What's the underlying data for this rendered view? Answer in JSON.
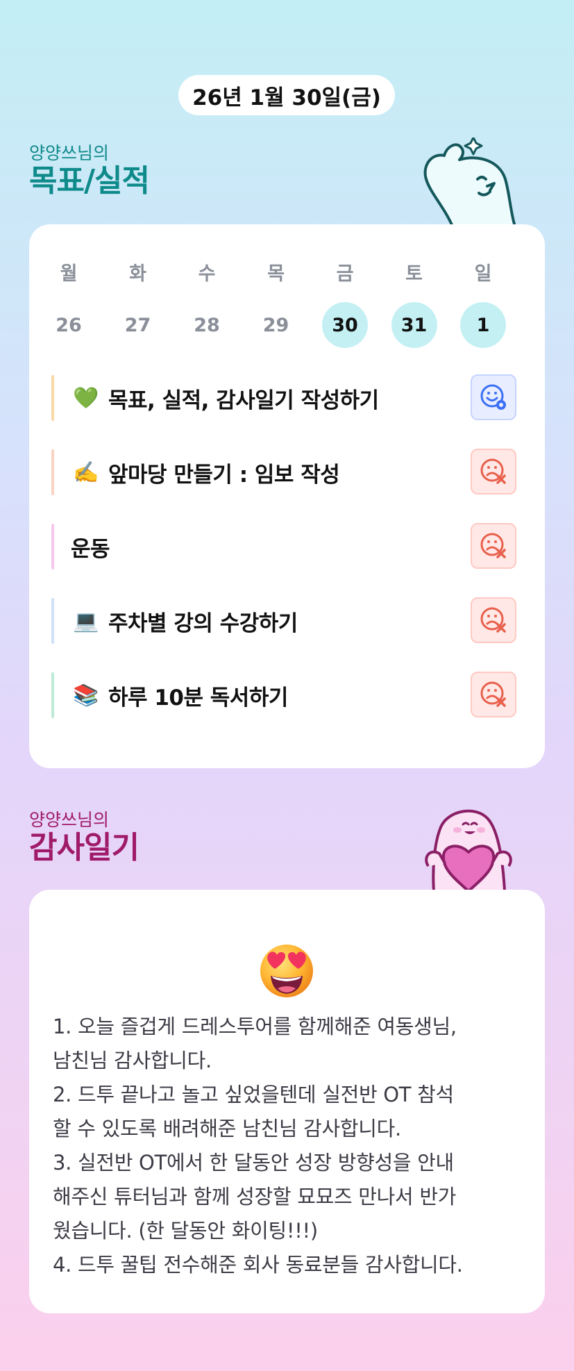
{
  "date": "26년 1월 30일(금)",
  "goal_section": {
    "owner": "양양쓰님의",
    "title": "목표/실적"
  },
  "week": {
    "days": [
      "월",
      "화",
      "수",
      "목",
      "금",
      "토",
      "일"
    ],
    "dates": [
      "26",
      "27",
      "28",
      "29",
      "30",
      "31",
      "1"
    ],
    "active_dates": [
      "30",
      "31",
      "1"
    ]
  },
  "goals": [
    {
      "emoji": "💚",
      "icon": "green-heart-icon",
      "text": "목표, 실적, 감사일기 작성하기",
      "status": "done",
      "bar_color": "#f8d9a8"
    },
    {
      "emoji": "✍️",
      "icon": "writing-hand-icon",
      "text": "앞마당 만들기 : 임보 작성",
      "status": "fail",
      "bar_color": "#fbd3c4"
    },
    {
      "emoji": "",
      "icon": "",
      "text": "운동",
      "status": "fail",
      "bar_color": "#f6c8ec"
    },
    {
      "emoji": "💻",
      "icon": "laptop-icon",
      "text": "주차별 강의 수강하기",
      "status": "fail",
      "bar_color": "#cfe0f7"
    },
    {
      "emoji": "📚",
      "icon": "books-icon",
      "text": "하루 10분 독서하기",
      "status": "fail",
      "bar_color": "#bfead8"
    }
  ],
  "diary_section": {
    "owner": "양양쓰님의",
    "title": "감사일기"
  },
  "diary": {
    "mood_icon": "heart-eyes-icon",
    "text": "1. 오늘 즐겁게 드레스투어를 함께해준 여동생님,\n남친님 감사합니다.\n2. 드투 끝나고 놀고 싶었을텐데 실전반 OT 참석\n할 수 있도록 배려해준 남친님 감사합니다.\n3. 실전반 OT에서 한 달동안 성장 방향성을 안내\n해주신 튜터님과 함께 성장할 묘묘즈 만나서 반가\n웠습니다. (한 달동안 화이팅!!!)\n4. 드투 꿀팁 전수해준 회사 동료분들 감사합니다."
  },
  "colors": {
    "goal_title": "#0f8a8a",
    "diary_title": "#a01a6a",
    "active_date_bg": "#c4f0f4",
    "ok_icon": "#3b6ff5",
    "fail_icon": "#e8604c"
  }
}
